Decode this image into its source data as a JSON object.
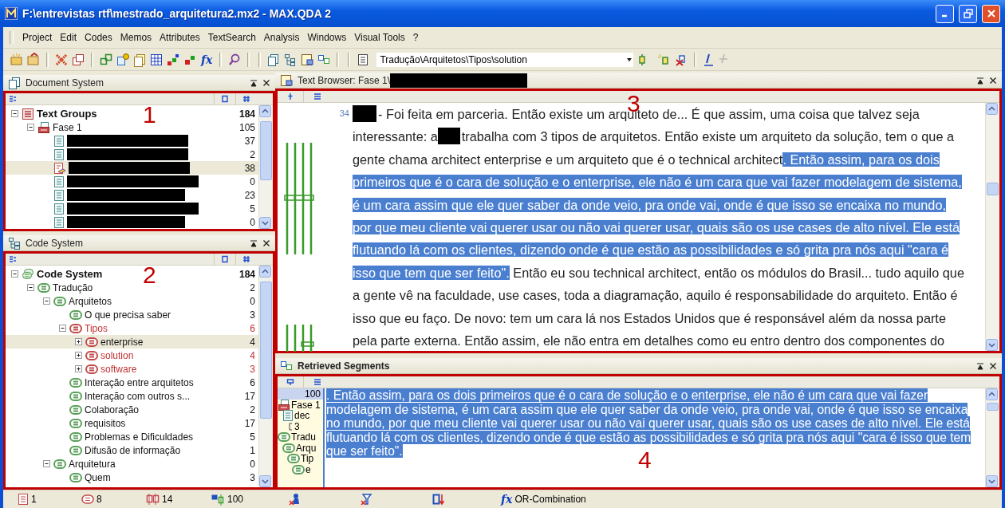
{
  "window": {
    "title": "F:\\entrevistas rtf\\mestrado_arquitetura2.mx2 - MAX.QDA 2"
  },
  "menu": [
    "Project",
    "Edit",
    "Codes",
    "Memos",
    "Attributes",
    "TextSearch",
    "Analysis",
    "Windows",
    "Visual Tools",
    "?"
  ],
  "toolbar": {
    "function_label": "fx",
    "code_path": "Tradução\\Arquitetos\\Tipos\\solution"
  },
  "document_system": {
    "title": "Document System",
    "annotation": "1",
    "items": [
      {
        "kind": "text-groups",
        "label": "Text Groups",
        "count": "184",
        "expanded": true,
        "selected": false,
        "children": [
          {
            "kind": "document-set",
            "label": "Fase 1",
            "count": "105",
            "expanded": true,
            "selected": false,
            "children": [
              {
                "kind": "document",
                "count": "37",
                "selected": false
              },
              {
                "kind": "document",
                "count": "2",
                "selected": false
              },
              {
                "kind": "document-open",
                "count": "38",
                "selected": true
              },
              {
                "kind": "document",
                "count": "0",
                "selected": false
              },
              {
                "kind": "document",
                "count": "23",
                "selected": false
              },
              {
                "kind": "document",
                "count": "5",
                "selected": false
              },
              {
                "kind": "document",
                "count": "0",
                "selected": false
              }
            ]
          }
        ]
      }
    ]
  },
  "code_system": {
    "title": "Code System",
    "annotation": "2",
    "items": [
      {
        "kind": "code-system",
        "label": "Code System",
        "count": "184",
        "expanded": true,
        "selected": false,
        "children": [
          {
            "kind": "code",
            "label": "Tradução",
            "count": "2",
            "expanded": true,
            "selected": false,
            "activated": false,
            "color": "#5aa05a",
            "children": [
              {
                "kind": "code",
                "label": "Arquitetos",
                "count": "0",
                "expanded": true,
                "selected": false,
                "activated": false,
                "color": "#5aa05a",
                "children": [
                  {
                    "kind": "code",
                    "label": "O que precisa saber",
                    "count": "3",
                    "selected": false,
                    "activated": false,
                    "color": "#5aa05a"
                  },
                  {
                    "kind": "code",
                    "label": "Tipos",
                    "count": "6",
                    "expanded": true,
                    "selected": false,
                    "activated": true,
                    "color": "#c24a4a",
                    "children": [
                      {
                        "kind": "code",
                        "label": "enterprise",
                        "count": "4",
                        "expanded": false,
                        "selected": true,
                        "activated": false,
                        "color": "#c24a4a"
                      },
                      {
                        "kind": "code",
                        "label": "solution",
                        "count": "4",
                        "expanded": false,
                        "selected": false,
                        "activated": true,
                        "color": "#c24a4a"
                      },
                      {
                        "kind": "code",
                        "label": "software",
                        "count": "3",
                        "expanded": false,
                        "selected": false,
                        "activated": true,
                        "color": "#c24a4a"
                      }
                    ]
                  },
                  {
                    "kind": "code",
                    "label": "Interação entre arquitetos",
                    "count": "6",
                    "selected": false,
                    "activated": false,
                    "color": "#5aa05a"
                  },
                  {
                    "kind": "code",
                    "label": "Interação com outros s...",
                    "count": "17",
                    "selected": false,
                    "activated": false,
                    "color": "#5aa05a"
                  },
                  {
                    "kind": "code",
                    "label": "Colaboração",
                    "count": "2",
                    "selected": false,
                    "activated": false,
                    "color": "#5aa05a"
                  },
                  {
                    "kind": "code",
                    "label": "requisitos",
                    "count": "17",
                    "selected": false,
                    "activated": false,
                    "color": "#5aa05a"
                  },
                  {
                    "kind": "code",
                    "label": "Problemas e Dificuldades",
                    "count": "5",
                    "selected": false,
                    "activated": false,
                    "color": "#5aa05a"
                  },
                  {
                    "kind": "code",
                    "label": "Difusão de informação",
                    "count": "1",
                    "selected": false,
                    "activated": false,
                    "color": "#5aa05a"
                  }
                ]
              },
              {
                "kind": "code",
                "label": "Arquitetura",
                "count": "0",
                "expanded": true,
                "selected": false,
                "activated": false,
                "color": "#5aa05a",
                "children": [
                  {
                    "kind": "code",
                    "label": "Quem",
                    "count": "3",
                    "selected": false,
                    "activated": false,
                    "color": "#5aa05a"
                  }
                ]
              }
            ]
          }
        ]
      }
    ]
  },
  "text_browser": {
    "title": "Text Browser: Fase 1\\",
    "annotation": "3",
    "paragraph_number": "34",
    "segments": [
      {
        "kind": "redaction"
      },
      {
        "kind": "text",
        "text": "- Foi feita em parceria. Então existe um arquiteto de... É que assim, uma coisa que talvez seja interessante: a",
        "highlighted": false
      },
      {
        "kind": "redaction"
      },
      {
        "kind": "text",
        "text": "trabalha com 3 tipos de arquitetos. Então existe um arquiteto da solução, tem o que a gente chama architect enterprise e um arquiteto que é o technical architect",
        "highlighted": false
      },
      {
        "kind": "text",
        "text": ". Então assim, para os dois primeiros que é o cara de solução e o enterprise, ele não é um cara que vai fazer modelagem de sistema, é um cara assim que ele quer saber da onde veio, pra onde vai, onde é que isso se encaixa no mundo, por que meu cliente vai querer usar ou não vai querer usar, quais são os use cases de alto nível. Ele está flutuando lá com os clientes, dizendo onde é que estão as possibilidades e só grita pra nós aqui \"cara é isso que tem que ser feito\".",
        "highlighted": true
      },
      {
        "kind": "text",
        "text": " Então eu sou technical architect, então os módulos do Brasil... tudo aquilo que a gente vê na faculdade, use cases, toda a diagramação, aquilo é responsabilidade do arquiteto. Então é isso que eu faço. De novo: tem um cara lá nos Estados Unidos que é responsável além da nossa parte pela parte externa. Então assim, ele não entra em detalhes como eu entro dentro dos componentes do",
        "highlighted": false
      }
    ]
  },
  "retrieved_segments": {
    "title": "Retrieved Segments",
    "annotation": "4",
    "count": "100",
    "sources": [
      {
        "kind": "document-set",
        "label": "Fase 1",
        "children": [
          {
            "kind": "document",
            "label": "dec",
            "children": [
              {
                "kind": "position",
                "label": "3"
              }
            ]
          }
        ]
      },
      {
        "kind": "code",
        "label": "Tradu",
        "children": [
          {
            "kind": "code",
            "label": "Arqu",
            "children": [
              {
                "kind": "code",
                "label": "Tip",
                "children": [
                  {
                    "kind": "code",
                    "label": "e"
                  }
                ]
              }
            ]
          }
        ]
      }
    ],
    "text": ". Então assim, para os dois primeiros que é o cara de solução e o enterprise, ele não é um cara que vai fazer modelagem de sistema, é um cara assim que ele quer saber da onde veio, pra onde vai, onde é que isso se encaixa no mundo, por que meu cliente vai querer usar ou não vai querer usar, quais são os use cases de alto nível. Ele está flutuando lá com os clientes, dizendo onde é que estão as possibilidades e só grita pra nós aqui \"cara é isso que tem que ser feito\".",
    "highlighted": true
  },
  "status_bar": [
    {
      "kind": "documents",
      "count": "1"
    },
    {
      "kind": "codes",
      "count": "8"
    },
    {
      "kind": "segments",
      "count": "14"
    },
    {
      "kind": "retrieved",
      "count": "100"
    },
    {
      "kind": "user"
    },
    {
      "kind": "filter"
    },
    {
      "kind": "sort"
    },
    {
      "kind": "function",
      "label": "fx",
      "text": "OR-Combination"
    }
  ]
}
